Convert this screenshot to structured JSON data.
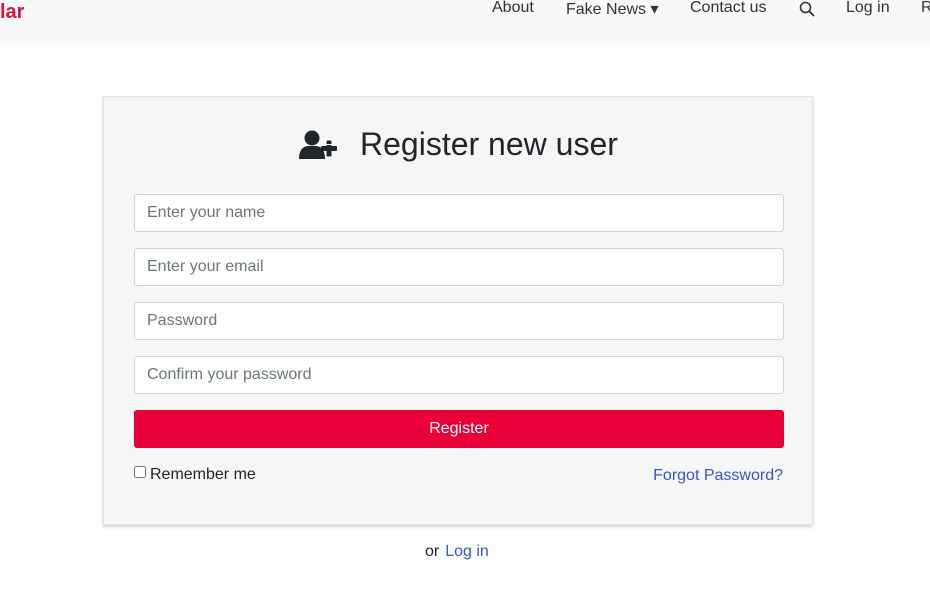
{
  "navbar": {
    "brand": "lar",
    "items": [
      {
        "label": "About"
      },
      {
        "label": "Fake News ▾"
      },
      {
        "label": "Contact us"
      },
      {
        "label": "Log in"
      },
      {
        "label": "R"
      }
    ],
    "search_icon": "search-icon"
  },
  "form": {
    "title": "Register new user",
    "title_icon": "user-plus-icon",
    "name_placeholder": "Enter your name",
    "email_placeholder": "Enter your email",
    "password_placeholder": "Password",
    "confirm_placeholder": "Confirm your password",
    "register_label": "Register",
    "remember_label": "Remember me",
    "remember_checked": false,
    "forgot_label": "Forgot Password?"
  },
  "footer": {
    "or_text": "or",
    "login_link": "Log in"
  },
  "colors": {
    "brand": "#dc143c",
    "primary_button": "#ea0039",
    "link": "#3756c9"
  }
}
